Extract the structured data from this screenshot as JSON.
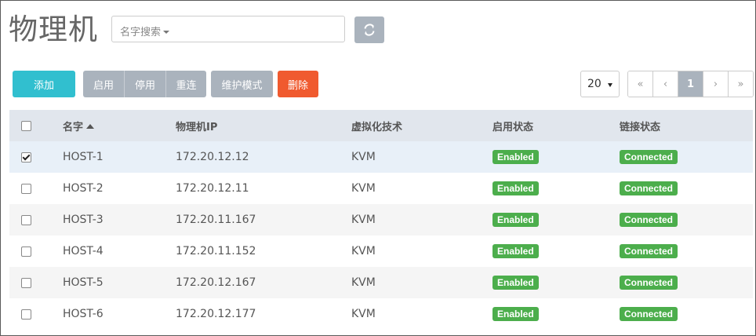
{
  "page": {
    "title": "物理机"
  },
  "search": {
    "placeholder": "名字搜索"
  },
  "toolbar": {
    "add_label": "添加",
    "enable_label": "启用",
    "disable_label": "停用",
    "reconnect_label": "重连",
    "maintenance_label": "维护模式",
    "delete_label": "删除",
    "page_size": "20"
  },
  "pagination": {
    "first": "«",
    "prev": "‹",
    "current": "1",
    "next": "›",
    "last": "»"
  },
  "table": {
    "headers": {
      "name": "名字",
      "ip": "物理机IP",
      "virt": "虚拟化技术",
      "enable": "启用状态",
      "link": "链接状态"
    },
    "rows": [
      {
        "name": "HOST-1",
        "ip": "172.20.12.12",
        "virt": "KVM",
        "enable": "Enabled",
        "link": "Connected",
        "checked": true
      },
      {
        "name": "HOST-2",
        "ip": "172.20.12.11",
        "virt": "KVM",
        "enable": "Enabled",
        "link": "Connected",
        "checked": false
      },
      {
        "name": "HOST-3",
        "ip": "172.20.11.167",
        "virt": "KVM",
        "enable": "Enabled",
        "link": "Connected",
        "checked": false
      },
      {
        "name": "HOST-4",
        "ip": "172.20.11.152",
        "virt": "KVM",
        "enable": "Enabled",
        "link": "Connected",
        "checked": false
      },
      {
        "name": "HOST-5",
        "ip": "172.20.12.167",
        "virt": "KVM",
        "enable": "Enabled",
        "link": "Connected",
        "checked": false
      },
      {
        "name": "HOST-6",
        "ip": "172.20.12.177",
        "virt": "KVM",
        "enable": "Enabled",
        "link": "Connected",
        "checked": false
      }
    ]
  },
  "colors": {
    "primary": "#31bfcf",
    "danger": "#f05a2f",
    "gray_button": "#aab3bd",
    "success_badge": "#4cae4c",
    "header_bg": "#e1e6ed"
  }
}
